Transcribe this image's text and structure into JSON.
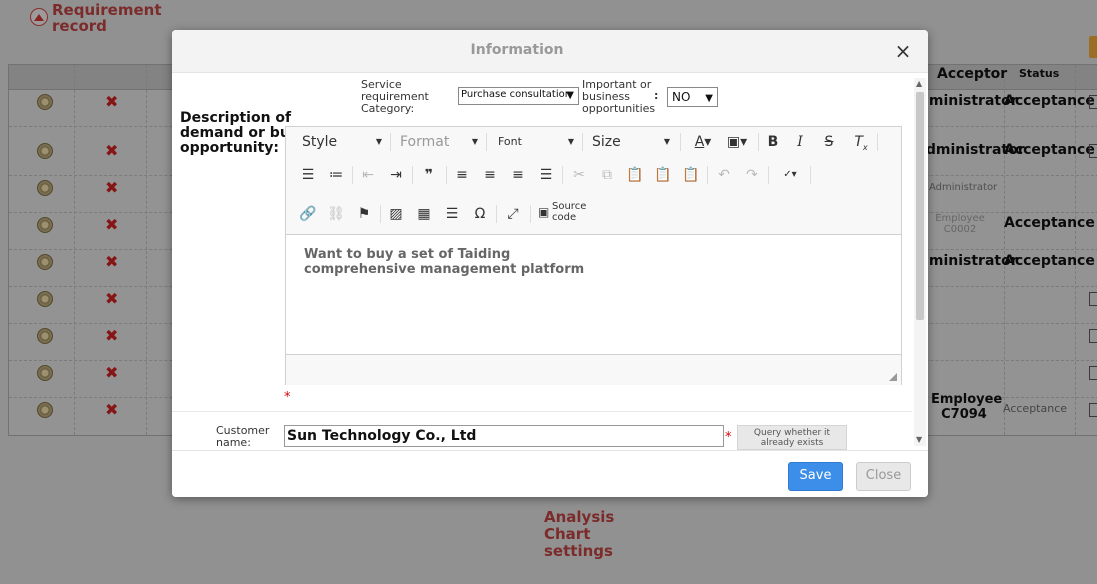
{
  "background": {
    "title": "Requirement record",
    "bottom_link": "Analysis Chart settings",
    "table": {
      "headers": {
        "acceptor": "Acceptor",
        "status": "Status"
      },
      "rows": [
        {
          "acceptor": "Administrator",
          "status": "Acceptance"
        },
        {
          "acceptor": "Administrator",
          "status": "Acceptance"
        },
        {
          "acceptor": "Administrator",
          "status": ""
        },
        {
          "acceptor": "Employee C0002",
          "status": "Acceptance"
        },
        {
          "acceptor": "Administrator",
          "status": "Acceptance"
        },
        {
          "acceptor": "",
          "status": ""
        },
        {
          "acceptor": "",
          "status": ""
        },
        {
          "acceptor": "",
          "status": ""
        },
        {
          "acceptor": "Employee C7094",
          "status": "Acceptance"
        }
      ]
    }
  },
  "modal": {
    "title": "Information",
    "close_icon": "×",
    "form": {
      "service_category_label": "Service requirement Category:",
      "service_category_value": "Purchase consultation",
      "important_label": "Important or business opportunities",
      "important_colon": ":",
      "important_value": "NO",
      "description_label": "Description of demand or business opportunity:",
      "description_text": "Want to buy a set of Taiding comprehensive management platform",
      "customer_label": "Customer name:",
      "customer_value": "Sun Technology Co., Ltd",
      "query_button": "Query whether it already exists",
      "required_mark": "*"
    },
    "editor": {
      "style_label": "Style",
      "format_label": "Format",
      "font_label": "Font",
      "size_label": "Size",
      "source_label": "Source code"
    },
    "footer": {
      "save": "Save",
      "close": "Close"
    }
  }
}
